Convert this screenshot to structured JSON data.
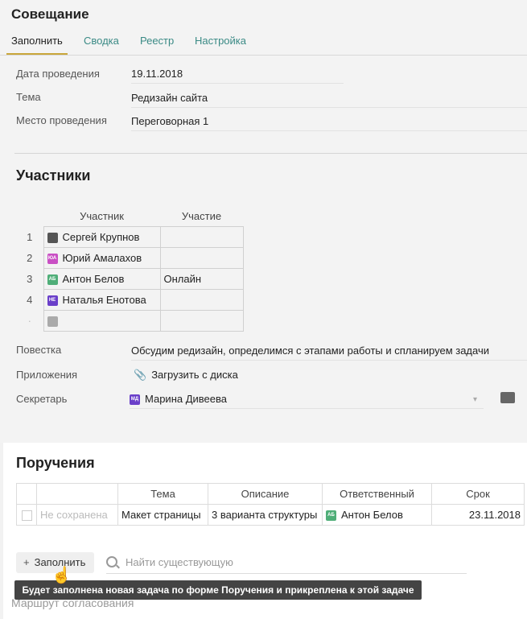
{
  "header": {
    "title": "Совещание"
  },
  "tabs": [
    {
      "label": "Заполнить"
    },
    {
      "label": "Сводка"
    },
    {
      "label": "Реестр"
    },
    {
      "label": "Настройка"
    }
  ],
  "form": {
    "date_label": "Дата проведения",
    "date_value": "19.11.2018",
    "topic_label": "Тема",
    "topic_value": "Редизайн сайта",
    "place_label": "Место проведения",
    "place_value": "Переговорная 1"
  },
  "participants": {
    "title": "Участники",
    "col_participant": "Участник",
    "col_participation": "Участие",
    "rows": [
      {
        "num": "1",
        "name": "Сергей Крупнов",
        "initials": "",
        "participation": ""
      },
      {
        "num": "2",
        "name": "Юрий Амалахов",
        "initials": "ЮА",
        "participation": ""
      },
      {
        "num": "3",
        "name": "Антон Белов",
        "initials": "АБ",
        "participation": "Онлайн"
      },
      {
        "num": "4",
        "name": "Наталья Енотова",
        "initials": "НЕ",
        "participation": ""
      }
    ]
  },
  "agenda": {
    "label": "Повестка",
    "value": "Обсудим редизайн, определимся с этапами работы и спланируем задачи"
  },
  "attachments": {
    "label": "Приложения",
    "upload": "Загрузить с диска"
  },
  "secretary": {
    "label": "Секретарь",
    "initials": "МД",
    "value": "Марина Дивеева"
  },
  "orders": {
    "title": "Поручения",
    "columns": [
      "Тема",
      "Описание",
      "Ответственный",
      "Срок"
    ],
    "row": {
      "status": "Не сохранена",
      "topic": "Макет страницы",
      "description": "3 варианта структуры",
      "resp_initials": "АБ",
      "responsible": "Антон Белов",
      "deadline": "23.11.2018"
    },
    "fill_button": "Заполнить",
    "search_placeholder": "Найти существующую",
    "tooltip": "Будет заполнена новая задача по форме Поручения и прикреплена к этой задаче"
  },
  "footer": {
    "route": "Маршрут согласования"
  },
  "colors": {
    "accent": "#c9a63a",
    "tab": "#3a8a85",
    "av_pink": "#c94fc4",
    "av_green": "#4fae78",
    "av_purple": "#6a3fc9"
  }
}
